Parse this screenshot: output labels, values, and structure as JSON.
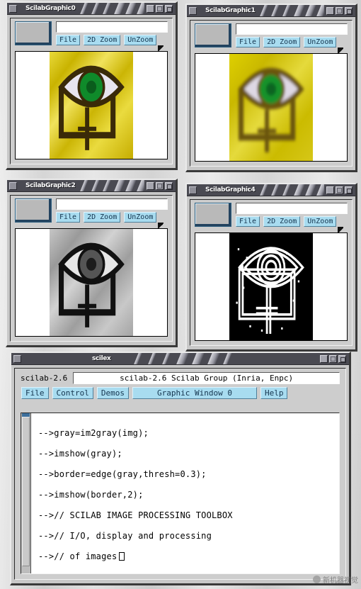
{
  "desktop": {
    "background_color": "#d2d2d2"
  },
  "windows": [
    {
      "id": "graphic0",
      "title": "ScilabGraphic0",
      "toolbar": {
        "field_value": "",
        "buttons": [
          "File",
          "2D Zoom",
          "UnZoom"
        ]
      },
      "image": {
        "name": "eye-logo-color",
        "description": "yellow textured eye logo with green iris",
        "bg": "#d8c81a",
        "iris": "#0f8a2a",
        "outline": "#3a2a08"
      }
    },
    {
      "id": "graphic1",
      "title": "ScilabGraphic1",
      "toolbar": {
        "field_value": "",
        "buttons": [
          "File",
          "2D Zoom",
          "UnZoom"
        ]
      },
      "image": {
        "name": "eye-logo-blurred",
        "description": "blurred yellow eye logo",
        "bg": "#d7c518",
        "iris": "#12922c",
        "outline": "#6a5410"
      }
    },
    {
      "id": "graphic2",
      "title": "ScilabGraphic2",
      "toolbar": {
        "field_value": "",
        "buttons": [
          "File",
          "2D Zoom",
          "UnZoom"
        ]
      },
      "image": {
        "name": "eye-logo-gray",
        "description": "grayscale eye logo",
        "bg": "#b0b0b0",
        "iris": "#555555",
        "outline": "#111111"
      }
    },
    {
      "id": "graphic4",
      "title": "ScilabGraphic4",
      "toolbar": {
        "field_value": "",
        "buttons": [
          "File",
          "2D Zoom",
          "UnZoom"
        ]
      },
      "image": {
        "name": "eye-logo-edges",
        "description": "edge detected eye logo, white outlines on black",
        "bg": "#000000",
        "iris": "#ffffff",
        "outline": "#ffffff"
      }
    }
  ],
  "console": {
    "title": "scilex",
    "version_label": "scilab-2.6",
    "banner": "scilab-2.6 Scilab Group (Inria, Enpc)",
    "menu": [
      {
        "label": "File",
        "wide": false
      },
      {
        "label": "Control",
        "wide": false
      },
      {
        "label": "Demos",
        "wide": false
      },
      {
        "label": "Graphic Window 0",
        "wide": true
      },
      {
        "label": "Help",
        "wide": false
      }
    ],
    "lines": [
      "-->gray=im2gray(img);",
      "-->imshow(gray);",
      "-->border=edge(gray,thresh=0.3);",
      "-->imshow(border,2);",
      "-->// SCILAB IMAGE PROCESSING TOOLBOX",
      "-->// I/O, display and processing",
      "-->// of images"
    ]
  },
  "watermark": {
    "text": "新机器视觉"
  }
}
